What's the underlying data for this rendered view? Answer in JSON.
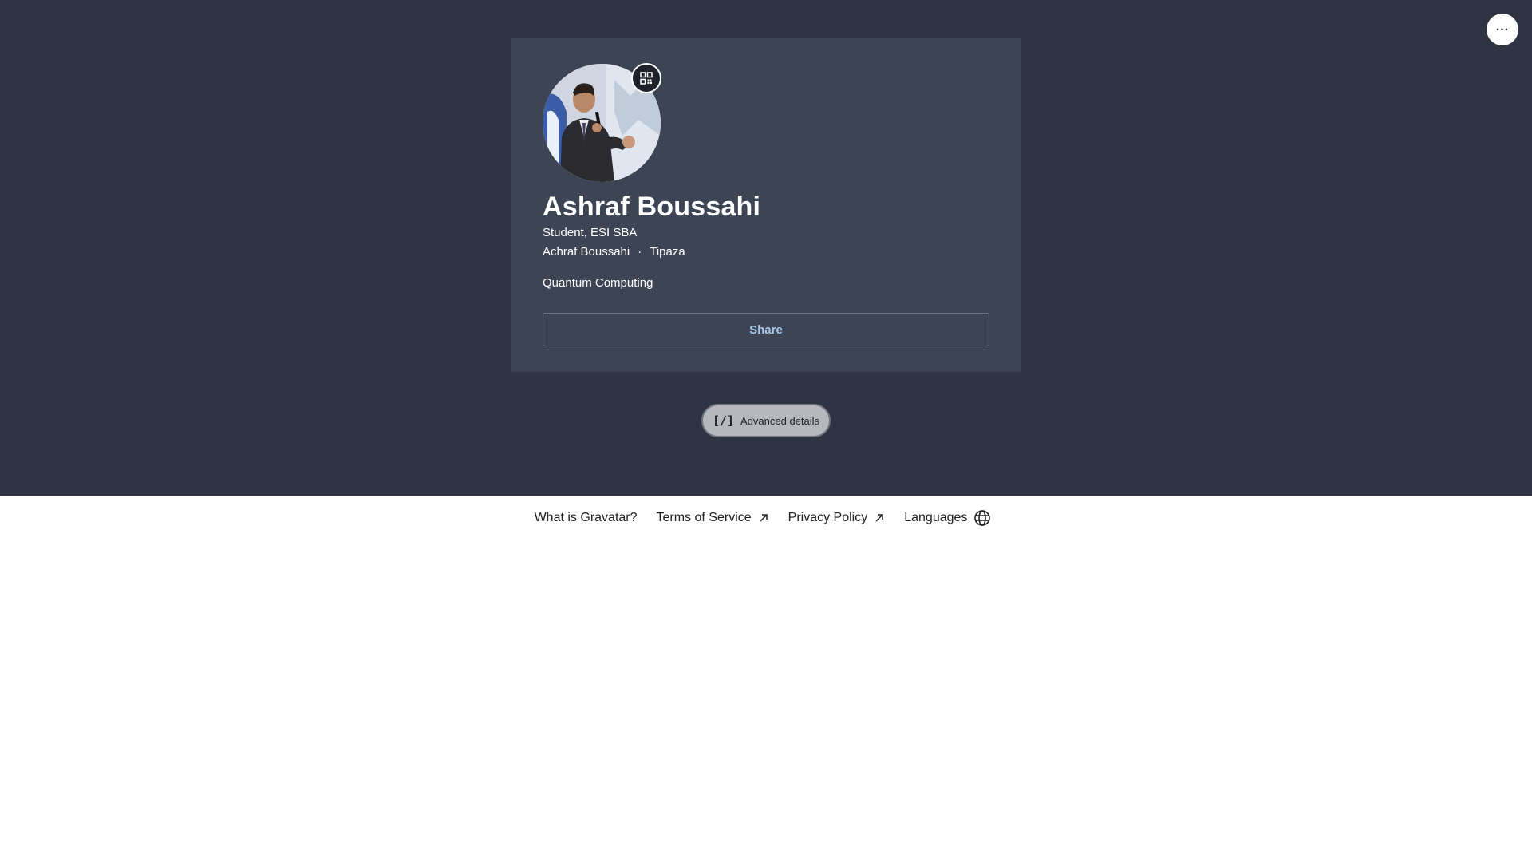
{
  "header": {
    "more_icon": "more-horizontal-icon",
    "more_label": "..."
  },
  "profile": {
    "name": "Ashraf Boussahi",
    "job_title": "Student, ESI SBA",
    "display_name": "Achraf Boussahi",
    "separator": "·",
    "location": "Tipaza",
    "about": "Quantum Computing",
    "share_label": "Share",
    "qr_icon": "qr-code-icon"
  },
  "advanced": {
    "icon_text": "[/]",
    "label": "Advanced details"
  },
  "footer": {
    "links": [
      {
        "label": "What is Gravatar?"
      },
      {
        "label": "Terms of Service",
        "icon": "external-arrow-icon"
      },
      {
        "label": "Privacy Policy",
        "icon": "external-arrow-icon"
      },
      {
        "label": "Languages",
        "icon": "globe-icon"
      }
    ]
  },
  "colors": {
    "hero_bg": "#2e3441",
    "card_bg": "#3d4454",
    "share_text": "#a7c7e7",
    "page_bg": "#ffffff"
  }
}
